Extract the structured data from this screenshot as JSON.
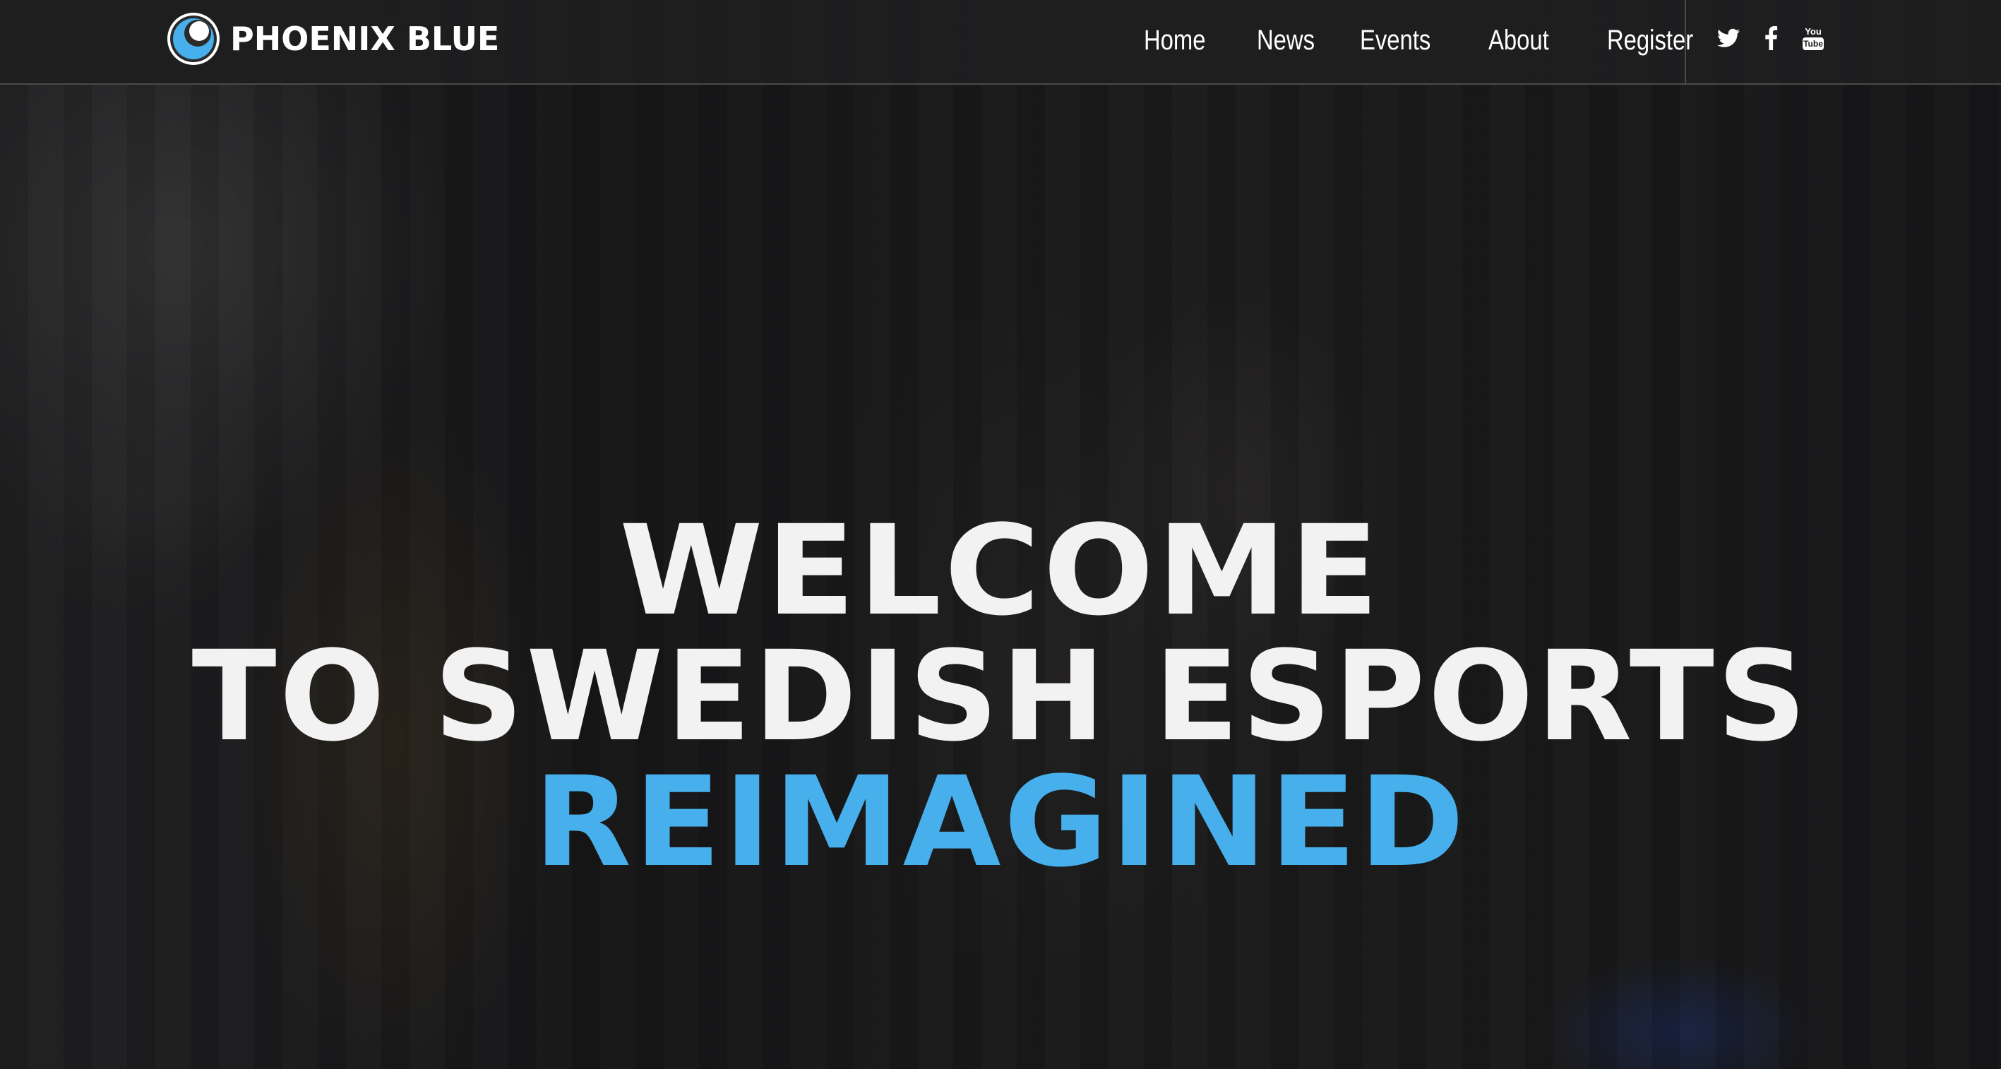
{
  "header": {
    "brand": "PHOENIX BLUE",
    "logo_icon": "phoenix-blue-logo-icon",
    "nav": [
      {
        "label": "Home"
      },
      {
        "label": "News"
      },
      {
        "label": "Events"
      },
      {
        "label": "About"
      },
      {
        "label": "Register"
      }
    ],
    "social": [
      {
        "icon": "twitter-icon"
      },
      {
        "icon": "facebook-icon"
      },
      {
        "icon": "youtube-icon",
        "text": "You Tube"
      }
    ]
  },
  "hero": {
    "line1": "WELCOME",
    "line2": "TO SWEDISH ESPORTS",
    "line3": "REIMAGINED"
  },
  "colors": {
    "accent": "#47b0ec",
    "header_bg": "#1e1e1f",
    "hero_text": "#f2f2f2"
  }
}
